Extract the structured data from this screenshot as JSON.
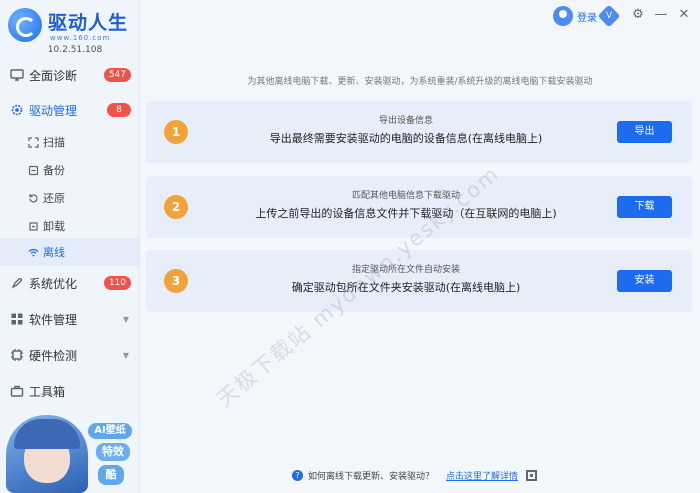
{
  "app": {
    "name": "驱动人生",
    "url": "www.160.com",
    "version": "10.2.51.108"
  },
  "header": {
    "login_label": "登录",
    "vip_label": "V"
  },
  "sidebar": {
    "items": [
      {
        "label": "全面诊断",
        "badge": "547",
        "icon": "monitor-icon"
      },
      {
        "label": "驱动管理",
        "badge": "8",
        "icon": "gear-icon"
      },
      {
        "label": "系统优化",
        "badge": "110",
        "icon": "rocket-icon"
      },
      {
        "label": "软件管理",
        "icon": "grid-icon"
      },
      {
        "label": "硬件检测",
        "icon": "chip-icon"
      },
      {
        "label": "工具箱",
        "icon": "toolbox-icon"
      }
    ],
    "sub_items": [
      {
        "label": "扫描",
        "icon": "scan-icon"
      },
      {
        "label": "备份",
        "icon": "backup-icon"
      },
      {
        "label": "还原",
        "icon": "restore-icon"
      },
      {
        "label": "卸载",
        "icon": "uninstall-icon"
      },
      {
        "label": "离线",
        "icon": "wifi-icon"
      }
    ],
    "promo": {
      "tag1": "AI壁纸",
      "tag2": "特效",
      "tag3": "酷"
    }
  },
  "main": {
    "subtitle": "为其他离线电脑下载、更新、安装驱动，为系统重装/系统升级的离线电脑下载安装驱动",
    "cards": [
      {
        "num": "1",
        "title": "导出设备信息",
        "desc": "导出最终需要安装驱动的电脑的设备信息(在离线电脑上)",
        "button": "导出"
      },
      {
        "num": "2",
        "title": "匹配其他电脑信息下载驱动",
        "desc": "上传之前导出的设备信息文件并下载驱动（在互联网的电脑上)",
        "button": "下载"
      },
      {
        "num": "3",
        "title": "指定驱动所在文件自动安装",
        "desc": "确定驱动包所在文件夹安装驱动(在离线电脑上)",
        "button": "安装"
      }
    ],
    "watermark": "天极下载站 mydown.yesky.com"
  },
  "footer": {
    "question": "如何离线下载更新、安装驱动？",
    "link": "点击这里了解详情"
  },
  "colors": {
    "accent": "#1d6cf0",
    "badge": "#f2524a",
    "step": "#f2a23a"
  }
}
